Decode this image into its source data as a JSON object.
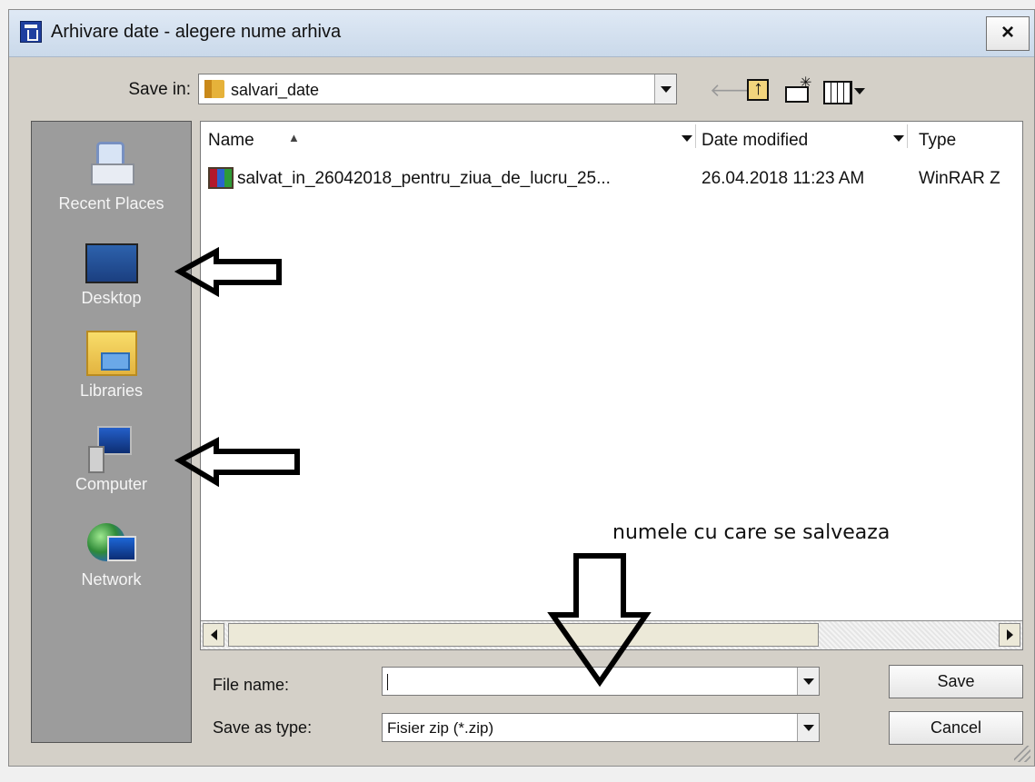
{
  "window": {
    "title": "Arhivare date - alegere nume arhiva"
  },
  "toolbar": {
    "save_in_label": "Save in:",
    "folder": "salvari_date"
  },
  "places": [
    {
      "label": "Recent Places",
      "icon": "recent-places-icon"
    },
    {
      "label": "Desktop",
      "icon": "desktop-icon"
    },
    {
      "label": "Libraries",
      "icon": "libraries-icon"
    },
    {
      "label": "Computer",
      "icon": "computer-icon"
    },
    {
      "label": "Network",
      "icon": "network-icon"
    }
  ],
  "columns": {
    "name": "Name",
    "date": "Date modified",
    "type": "Type"
  },
  "files": [
    {
      "name": "salvat_in_26042018_pentru_ziua_de_lucru_25...",
      "date": "26.04.2018 11:23 AM",
      "type": "WinRAR Z"
    }
  ],
  "form": {
    "file_name_label": "File name:",
    "file_name_value": "",
    "save_as_type_label": "Save as type:",
    "save_as_type_value": "Fisier zip (*.zip)"
  },
  "buttons": {
    "save": "Save",
    "cancel": "Cancel",
    "close": "×"
  },
  "annotation": {
    "text": "numele cu care se salveaza"
  }
}
